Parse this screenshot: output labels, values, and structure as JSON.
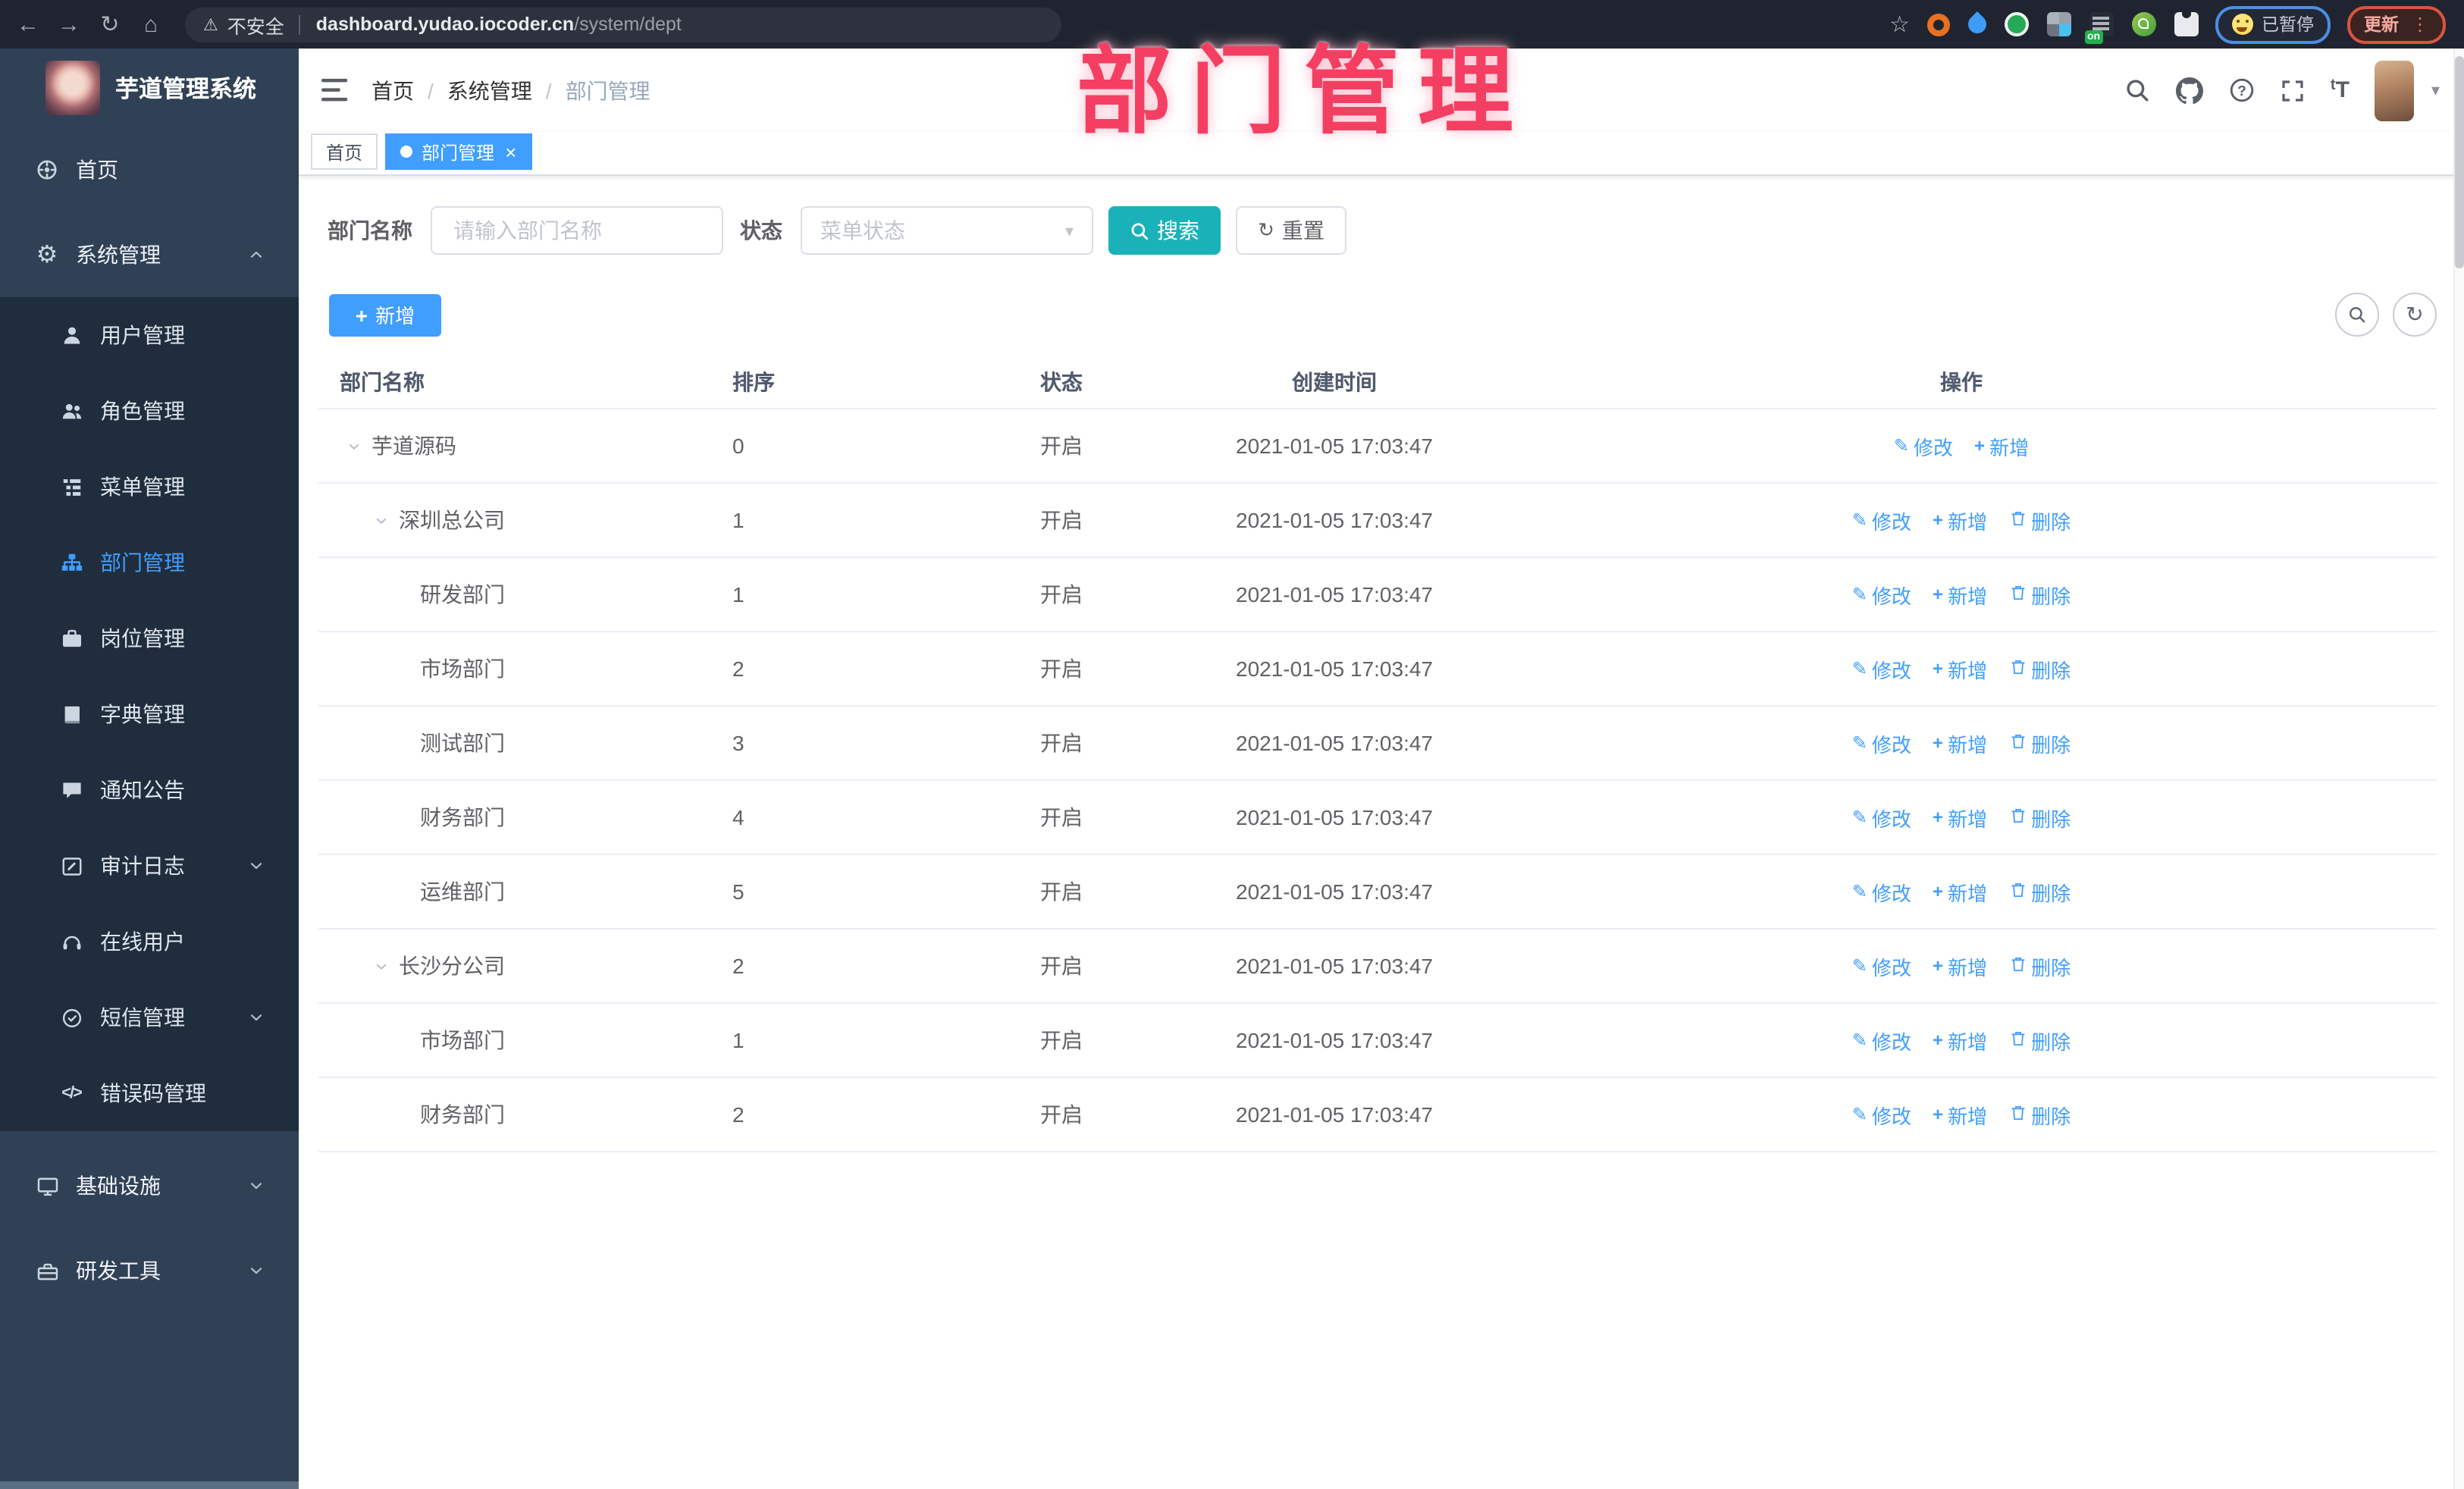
{
  "colors": {
    "accent": "#409eff",
    "search_button": "#1ab2b8",
    "sidebar_bg": "#304156",
    "submenu_bg": "#1f2d3d",
    "overlay_pink": "#f43f63",
    "link": "#409eff"
  },
  "overlay_title": "部门管理",
  "browser": {
    "security_label": "不安全",
    "url_domain": "dashboard.yudao.iocoder.cn",
    "url_path": "/system/dept",
    "paused_badge": "已暂停",
    "update_button": "更新",
    "extensions": [
      {
        "name": "orange-ring-extension-icon"
      },
      {
        "name": "blue-drop-extension-icon"
      },
      {
        "name": "green-circle-extension-icon"
      },
      {
        "name": "grid-extension-icon"
      },
      {
        "name": "adblock-extension-icon",
        "badge": "on"
      },
      {
        "name": "green-key-extension-icon"
      },
      {
        "name": "puzzle-extension-icon"
      }
    ]
  },
  "sidebar": {
    "logo_title": "芋道管理系统",
    "items": [
      {
        "label": "首页",
        "icon": "dashboard-icon",
        "depth": "root"
      },
      {
        "label": "系统管理",
        "icon": "gear-icon",
        "depth": "root",
        "chevron": "up"
      },
      {
        "label": "用户管理",
        "icon": "user-icon",
        "depth": "sub"
      },
      {
        "label": "角色管理",
        "icon": "users-icon",
        "depth": "sub"
      },
      {
        "label": "菜单管理",
        "icon": "menu-tree-icon",
        "depth": "sub"
      },
      {
        "label": "部门管理",
        "icon": "org-tree-icon",
        "depth": "sub",
        "active": true
      },
      {
        "label": "岗位管理",
        "icon": "briefcase-icon",
        "depth": "sub"
      },
      {
        "label": "字典管理",
        "icon": "dictionary-icon",
        "depth": "sub"
      },
      {
        "label": "通知公告",
        "icon": "announcement-icon",
        "depth": "sub"
      },
      {
        "label": "审计日志",
        "icon": "audit-log-icon",
        "depth": "sub",
        "chevron": "down"
      },
      {
        "label": "在线用户",
        "icon": "headset-icon",
        "depth": "sub"
      },
      {
        "label": "短信管理",
        "icon": "sms-icon",
        "depth": "sub",
        "chevron": "down"
      },
      {
        "label": "错误码管理",
        "icon": "code-icon",
        "depth": "sub"
      },
      {
        "label": "基础设施",
        "icon": "monitor-icon",
        "depth": "root",
        "chevron": "down",
        "gap_before": true
      },
      {
        "label": "研发工具",
        "icon": "toolbox-icon",
        "depth": "root",
        "chevron": "down"
      }
    ]
  },
  "header": {
    "breadcrumb": [
      "首页",
      "系统管理",
      "部门管理"
    ]
  },
  "tabs": [
    {
      "label": "首页",
      "active": false,
      "closable": false
    },
    {
      "label": "部门管理",
      "active": true,
      "closable": true
    }
  ],
  "filters": {
    "name_label": "部门名称",
    "name_placeholder": "请输入部门名称",
    "status_label": "状态",
    "status_placeholder": "菜单状态",
    "search_label": "搜索",
    "reset_label": "重置"
  },
  "toolbar": {
    "add_label": "新增"
  },
  "table": {
    "columns": [
      "部门名称",
      "排序",
      "状态",
      "创建时间",
      "操作"
    ],
    "action_labels": {
      "edit": "修改",
      "add": "新增",
      "delete": "删除"
    },
    "rows": [
      {
        "name": "芋道源码",
        "level": 0,
        "expandable": true,
        "sort": "0",
        "status": "开启",
        "created": "2021-01-05 17:03:47",
        "actions": [
          "edit",
          "add"
        ]
      },
      {
        "name": "深圳总公司",
        "level": 1,
        "expandable": true,
        "sort": "1",
        "status": "开启",
        "created": "2021-01-05 17:03:47",
        "actions": [
          "edit",
          "add",
          "delete"
        ]
      },
      {
        "name": "研发部门",
        "level": 2,
        "expandable": false,
        "sort": "1",
        "status": "开启",
        "created": "2021-01-05 17:03:47",
        "actions": [
          "edit",
          "add",
          "delete"
        ]
      },
      {
        "name": "市场部门",
        "level": 2,
        "expandable": false,
        "sort": "2",
        "status": "开启",
        "created": "2021-01-05 17:03:47",
        "actions": [
          "edit",
          "add",
          "delete"
        ]
      },
      {
        "name": "测试部门",
        "level": 2,
        "expandable": false,
        "sort": "3",
        "status": "开启",
        "created": "2021-01-05 17:03:47",
        "actions": [
          "edit",
          "add",
          "delete"
        ]
      },
      {
        "name": "财务部门",
        "level": 2,
        "expandable": false,
        "sort": "4",
        "status": "开启",
        "created": "2021-01-05 17:03:47",
        "actions": [
          "edit",
          "add",
          "delete"
        ]
      },
      {
        "name": "运维部门",
        "level": 2,
        "expandable": false,
        "sort": "5",
        "status": "开启",
        "created": "2021-01-05 17:03:47",
        "actions": [
          "edit",
          "add",
          "delete"
        ]
      },
      {
        "name": "长沙分公司",
        "level": 1,
        "expandable": true,
        "sort": "2",
        "status": "开启",
        "created": "2021-01-05 17:03:47",
        "actions": [
          "edit",
          "add",
          "delete"
        ]
      },
      {
        "name": "市场部门",
        "level": 2,
        "expandable": false,
        "sort": "1",
        "status": "开启",
        "created": "2021-01-05 17:03:47",
        "actions": [
          "edit",
          "add",
          "delete"
        ]
      },
      {
        "name": "财务部门",
        "level": 2,
        "expandable": false,
        "sort": "2",
        "status": "开启",
        "created": "2021-01-05 17:03:47",
        "actions": [
          "edit",
          "add",
          "delete"
        ]
      }
    ]
  }
}
